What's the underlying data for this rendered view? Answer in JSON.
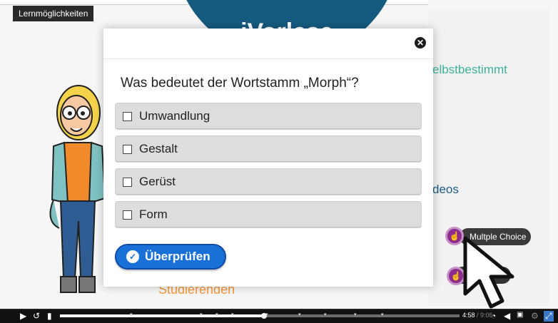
{
  "header": {
    "label": "Lernmöglichkeiten"
  },
  "background": {
    "title": "iVorlese",
    "right_text": "elbstbestimmt",
    "video_text": "deos",
    "bottom_text": "Studierenden"
  },
  "modal": {
    "question": "Was bedeutet der Wortstamm „Morph“?",
    "options": [
      "Umwandlung",
      "Gestalt",
      "Gerüst",
      "Form"
    ],
    "check_label": "Überprüfen",
    "close_icon": "close-icon"
  },
  "hotspots": {
    "tooltip": "Multple Choice",
    "icon": "hand-pointer-icon"
  },
  "player": {
    "time_current": "4:58",
    "time_total": " / 9:06",
    "progress": 0.51,
    "icons": [
      "play-icon",
      "rewind-10-icon",
      "bookmark-icon",
      "speed-icon",
      "volume-icon",
      "captions-icon",
      "settings-icon",
      "fullscreen-icon"
    ]
  },
  "colors": {
    "accent": "#1971d8",
    "hotspot": "#8e2c8e",
    "title_bg": "#155a7f",
    "teal_text": "#3eb29a",
    "orange_text": "#f49a3b"
  }
}
